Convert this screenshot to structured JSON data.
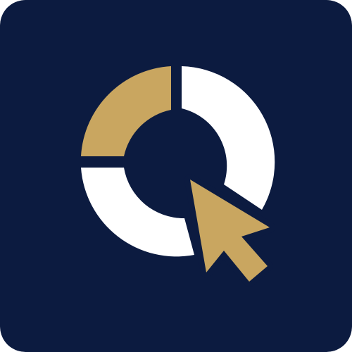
{
  "app_icon": {
    "icon": "chart-cursor-logo-icon",
    "colors": {
      "background": "#0c1b40",
      "gold": "#c9a660",
      "white": "#ffffff"
    },
    "segments": [
      {
        "name": "top-left-segment",
        "color": "gold"
      },
      {
        "name": "top-right-segment",
        "color": "white"
      },
      {
        "name": "bottom-segment",
        "color": "white"
      }
    ],
    "cursor": {
      "icon": "cursor-arrow-icon",
      "color": "gold"
    }
  }
}
